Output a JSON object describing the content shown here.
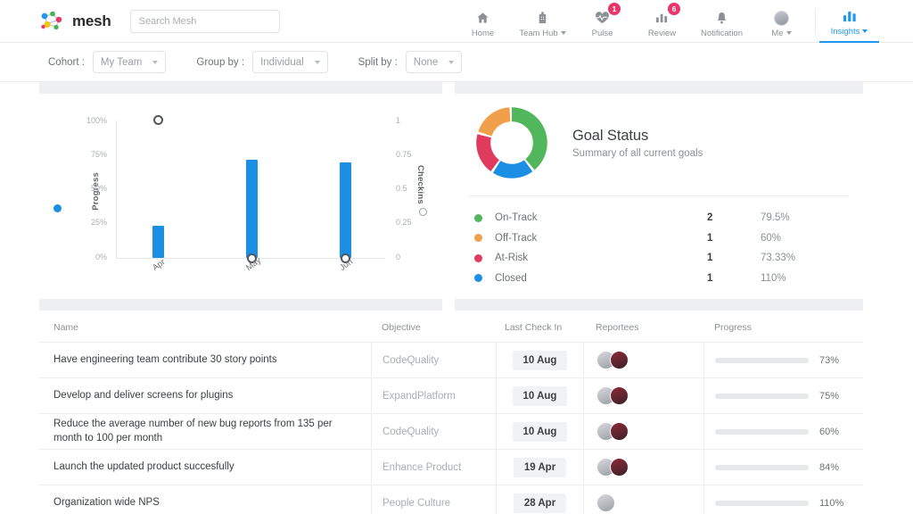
{
  "brand": {
    "name": "mesh",
    "logo_icon": "mesh-logo-icon"
  },
  "search": {
    "placeholder": "Search Mesh",
    "value": "",
    "icon": "search-icon"
  },
  "nav": {
    "items": [
      {
        "label": "Home",
        "icon": "home-icon",
        "badge": "",
        "caret": false,
        "active": false
      },
      {
        "label": "Team Hub",
        "icon": "team-hub-icon",
        "badge": "",
        "caret": true,
        "active": false
      },
      {
        "label": "Pulse",
        "icon": "pulse-heart-icon",
        "badge": "1",
        "caret": false,
        "active": false
      },
      {
        "label": "Review",
        "icon": "review-chart-icon",
        "badge": "6",
        "caret": false,
        "active": false
      },
      {
        "label": "Notification",
        "icon": "bell-icon",
        "badge": "",
        "caret": false,
        "active": false
      },
      {
        "label": "Me",
        "icon": "avatar-icon",
        "badge": "",
        "caret": true,
        "active": false
      },
      {
        "label": "Insights",
        "icon": "insights-bars-icon",
        "badge": "",
        "caret": true,
        "active": true
      }
    ]
  },
  "filters": [
    {
      "label": "Cohort :",
      "value": "My Team"
    },
    {
      "label": "Group by :",
      "value": "Individual"
    },
    {
      "label": "Split by :",
      "value": "None"
    }
  ],
  "colors": {
    "accent": "#2196f3",
    "bar": "#1a8fe3",
    "on_track": "#52b65c",
    "off_track": "#f0a04b",
    "at_risk": "#e03a5f",
    "closed": "#1a8fe3",
    "badge": "#e8366b",
    "progress_pink": "#e8477e",
    "progress_green": "#5cc45f",
    "progress_orange": "#f0a44b",
    "progress_dark_green": "#2aa22a"
  },
  "goal_status": {
    "title": "Goal Status",
    "subtitle": "Summary of all current goals",
    "legend": [
      {
        "name": "On-Track",
        "count": "2",
        "percent": "79.5%",
        "color": "#52b65c"
      },
      {
        "name": "Off-Track",
        "count": "1",
        "percent": "60%",
        "color": "#f0a04b"
      },
      {
        "name": "At-Risk",
        "count": "1",
        "percent": "73.33%",
        "color": "#e03a5f"
      },
      {
        "name": "Closed",
        "count": "1",
        "percent": "110%",
        "color": "#1a8fe3"
      }
    ]
  },
  "chart_data": {
    "type": "bar",
    "title": "",
    "categories": [
      "Apr",
      "May",
      "Jun"
    ],
    "series": [
      {
        "name": "Progress",
        "type": "bar",
        "axis": "left",
        "values": [
          23,
          71,
          69
        ],
        "color": "#1a8fe3"
      },
      {
        "name": "Checkins",
        "type": "scatter",
        "axis": "right",
        "values": [
          1,
          0,
          0
        ],
        "color": "#52575c"
      }
    ],
    "xlabel": "",
    "ylabel": "Progress",
    "y2label": "Checkins",
    "ylim": [
      0,
      100
    ],
    "y2lim": [
      0,
      1
    ],
    "yticks": [
      "0%",
      "25%",
      "50%",
      "75%",
      "100%"
    ],
    "y2ticks": [
      "0",
      "0.25",
      "0.5",
      "0.75",
      "1"
    ],
    "grid": false,
    "legend": [
      "Progress",
      "Checkins"
    ]
  },
  "table": {
    "columns": [
      "Name",
      "Objective",
      "Last Check In",
      "Reportees",
      "Progress"
    ],
    "rows": [
      {
        "name": "Have engineering team contribute 30 story points",
        "objective": "CodeQuality",
        "check_in": "10 Aug",
        "reportees": 2,
        "progress_value": 73,
        "progress_label": "73%",
        "progress_color": "#e8477e"
      },
      {
        "name": "Develop and deliver screens for plugins",
        "objective": "ExpandPlatform",
        "check_in": "10 Aug",
        "reportees": 2,
        "progress_value": 75,
        "progress_label": "75%",
        "progress_color": "#5cc45f"
      },
      {
        "name": "Reduce the average number of new bug reports from 135 per month to 100 per month",
        "objective": "CodeQuality",
        "check_in": "10 Aug",
        "reportees": 2,
        "progress_value": 60,
        "progress_label": "60%",
        "progress_color": "#f0a44b"
      },
      {
        "name": "Launch the updated product succesfully",
        "objective": "Enhance Product",
        "check_in": "19 Apr",
        "reportees": 2,
        "progress_value": 84,
        "progress_label": "84%",
        "progress_color": "#5cc45f"
      },
      {
        "name": "Organization wide NPS",
        "objective": "People Culture",
        "check_in": "28 Apr",
        "reportees": 1,
        "progress_value": 100,
        "progress_label": "110%",
        "progress_color": "#2aa22a"
      }
    ]
  }
}
